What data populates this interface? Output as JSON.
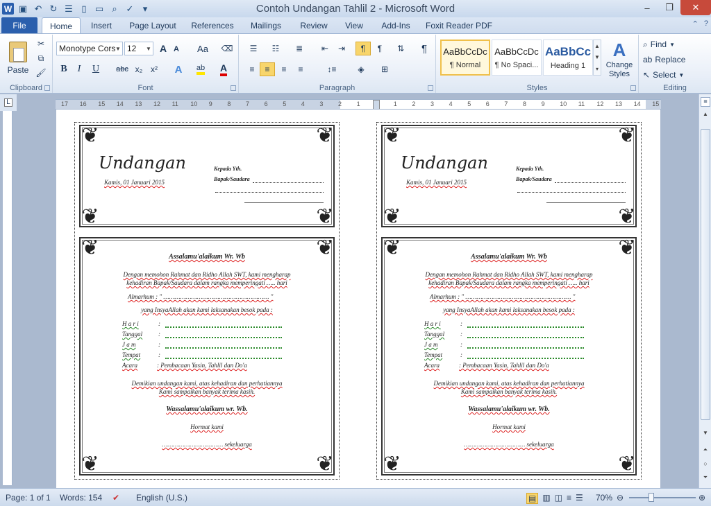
{
  "window": {
    "title": "Contoh Undangan Tahlil 2  -  Microsoft Word",
    "minimize": "–",
    "restore": "❐",
    "close": "✕",
    "help": "?"
  },
  "ribbon_tabs": {
    "file": "File",
    "items": [
      "Home",
      "Insert",
      "Page Layout",
      "References",
      "Mailings",
      "Review",
      "View",
      "Add-Ins",
      "Foxit Reader PDF"
    ]
  },
  "clipboard": {
    "paste": "Paste",
    "label": "Clipboard"
  },
  "font": {
    "name": "Monotype Cors",
    "size": "12",
    "label": "Font",
    "bold": "B",
    "italic": "I",
    "underline": "U",
    "strike": "abc",
    "sub": "x₂",
    "sup": "x²",
    "aa": "Aa",
    "grow": "A",
    "shrink": "A"
  },
  "paragraph": {
    "label": "Paragraph",
    "pilcrow": "¶"
  },
  "styles": {
    "label": "Styles",
    "items": [
      {
        "preview": "AaBbCcDc",
        "name": "¶ Normal"
      },
      {
        "preview": "AaBbCcDc",
        "name": "¶ No Spaci..."
      },
      {
        "preview": "AaBbCc",
        "name": "Heading 1"
      }
    ],
    "change": "Change Styles"
  },
  "editing": {
    "label": "Editing",
    "find": "Find",
    "replace": "Replace",
    "select": "Select"
  },
  "ruler": {
    "ticks": [
      "17",
      "16",
      "15",
      "14",
      "13",
      "12",
      "11",
      "10",
      "9",
      "8",
      "7",
      "6",
      "5",
      "4",
      "3",
      "2",
      "1",
      "",
      "1",
      "2",
      "3",
      "4",
      "5",
      "6",
      "7",
      "8",
      "9",
      "10",
      "11",
      "12",
      "13",
      "14",
      "15"
    ]
  },
  "card": {
    "title": "Undangan",
    "date": "Kamis, 01 Januari 2015",
    "to": "Kepada Yth.",
    "to2": "Bapak/Saudara",
    "greeting": "Assalamu'alaikum Wr. Wb",
    "p1a": "Dengan memohon  Rahmat dan Ridho Allah SWT, kami mengharap",
    "p1b": "kehadiran Bapak/Saudara dalam rangka memperingati ….. hari",
    "almarhum": "Almarhum : \" ………………………………………………… \"",
    "p2": "yang InsyaAllah akan kami laksanakan besok pada :",
    "rows": [
      {
        "k": "H a r i",
        "v": ":"
      },
      {
        "k": "Tanggal",
        "v": ":"
      },
      {
        "k": "J a m",
        "v": ":"
      },
      {
        "k": "Tempat",
        "v": ":"
      }
    ],
    "acara_k": "Acara",
    "acara_v": ":     Pembacaan Yasin, Tahlil dan Do'a",
    "p3a": "Demikian undangan kami, atas kehadiran dan perhatiannya",
    "p3b": "Kami sampaikan banyak terima kasih.",
    "closing": "Wassalamu'alaikum wr. Wb.",
    "hormat": "Hormat kami",
    "sign": "…………………………… sekeluarga"
  },
  "status": {
    "page": "Page: 1 of 1",
    "words": "Words: 154",
    "lang": "English (U.S.)",
    "zoom": "70%"
  }
}
